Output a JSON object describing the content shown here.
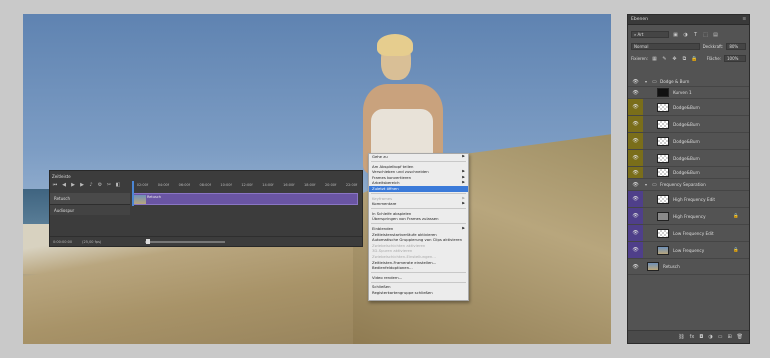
{
  "colors": {
    "olive": "#7a6e1a",
    "purple": "#4f3f8a",
    "accent": "#3b7ad9",
    "clip": "#6a55a3"
  },
  "timeline": {
    "title": "Zeitleiste",
    "ruler": [
      "02:00f",
      "04:00f",
      "06:00f",
      "08:00f",
      "10:00f",
      "12:00f",
      "14:00f",
      "16:00f",
      "18:00f",
      "20:00f",
      "22:00f"
    ],
    "track1": "Retusch",
    "track2": "Audiospur",
    "clip_label": "Retusch",
    "timecode": "0:00:00:00",
    "fps": "(25,00 fps)",
    "controls": [
      "first-frame-icon",
      "prev-frame-icon",
      "play-icon",
      "next-frame-icon",
      "audio-icon",
      "settings-icon",
      "split-icon",
      "transition-icon"
    ]
  },
  "context_menu": {
    "items": [
      {
        "label": "Gehe zu",
        "submenu": true
      },
      {
        "sep": true
      },
      {
        "label": "Am Abspielkopf teilen"
      },
      {
        "label": "Verschieben und zuschneiden",
        "submenu": true
      },
      {
        "label": "Frames konvertieren",
        "submenu": true
      },
      {
        "label": "Arbeitsbereich",
        "submenu": true
      },
      {
        "label": "Zuletzt öffnen",
        "highlight": true
      },
      {
        "sep": true
      },
      {
        "label": "Keyframes",
        "submenu": true,
        "disabled": true
      },
      {
        "label": "Kommentare",
        "submenu": true
      },
      {
        "sep": true
      },
      {
        "label": "In Schleife abspielen"
      },
      {
        "label": "Überspringen von Frames zulassen"
      },
      {
        "sep": true
      },
      {
        "label": "Einblenden",
        "submenu": true
      },
      {
        "label": "Zeitleistenstartverläufe aktivieren"
      },
      {
        "label": "Automatische Gruppierung von Clips aktivieren"
      },
      {
        "label": "Zwiebelschichten aktivieren",
        "disabled": true
      },
      {
        "label": "3D-Spuren aktivieren",
        "disabled": true
      },
      {
        "label": "Zwiebelschichten-Einstellungen...",
        "disabled": true
      },
      {
        "label": "Zeitleisten-Framerate einstellen..."
      },
      {
        "label": "Bedienfeldoptionen..."
      },
      {
        "sep": true
      },
      {
        "label": "Video rendern..."
      },
      {
        "sep": true
      },
      {
        "label": "Schließen"
      },
      {
        "label": "Registerkartengruppe schließen"
      }
    ]
  },
  "layers_panel": {
    "title": "Ebenen",
    "filter_kind": "Art",
    "blend_mode": "Normal",
    "opacity_label": "Deckkraft:",
    "opacity_value": "80%",
    "lock_label": "Fixieren:",
    "fill_label": "Fläche:",
    "fill_value": "100%",
    "layers": [
      {
        "name": "Dodge & Burn",
        "type": "group",
        "color": "none"
      },
      {
        "name": "Kurven 1",
        "type": "adjustment",
        "color": "none"
      },
      {
        "name": "Dodge&Burn",
        "type": "layer",
        "color": "olive"
      },
      {
        "name": "Dodge&Burn",
        "type": "layer",
        "color": "olive"
      },
      {
        "name": "Dodge&Burn",
        "type": "layer",
        "color": "olive"
      },
      {
        "name": "Dodge&Burn",
        "type": "layer",
        "color": "olive"
      },
      {
        "name": "Dodge&Burn",
        "type": "layer",
        "color": "olive"
      },
      {
        "name": "Frequency Separation",
        "type": "group",
        "color": "none"
      },
      {
        "name": "High Frequency Edit",
        "type": "layer",
        "color": "purple"
      },
      {
        "name": "High Frequency",
        "type": "layer",
        "color": "purple",
        "locked": true
      },
      {
        "name": "Low Frequency Edit",
        "type": "layer",
        "color": "purple"
      },
      {
        "name": "Low Frequency",
        "type": "layer",
        "color": "purple",
        "locked": true
      },
      {
        "name": "Retusch",
        "type": "layer",
        "color": "none"
      }
    ],
    "bottom_icons": [
      "link-icon",
      "fx-icon",
      "mask-icon",
      "adjustment-icon",
      "folder-icon",
      "new-layer-icon",
      "trash-icon"
    ]
  }
}
